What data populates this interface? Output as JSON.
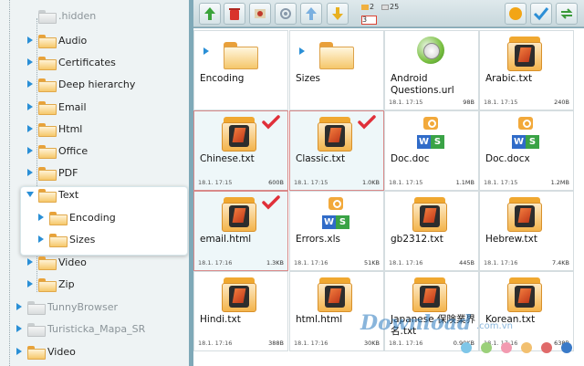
{
  "tree": {
    "items": [
      {
        "label": ".hidden",
        "dim": true
      },
      {
        "label": "Audio"
      },
      {
        "label": "Certificates"
      },
      {
        "label": "Deep hierarchy"
      },
      {
        "label": "Email"
      },
      {
        "label": "Html"
      },
      {
        "label": "Office"
      },
      {
        "label": "PDF"
      },
      {
        "label": "Text",
        "expanded": true
      },
      {
        "label": "Encoding"
      },
      {
        "label": "Sizes"
      },
      {
        "label": "Video"
      },
      {
        "label": "Zip"
      },
      {
        "label": "TunnyBrowser",
        "dim": true
      },
      {
        "label": "Turisticka_Mapa_SR",
        "dim": true
      },
      {
        "label": "Video"
      }
    ]
  },
  "toolbar": {
    "buttons": [
      "up-arrow-icon",
      "delete-icon",
      "cut-icon",
      "settings-icon",
      "upload-icon",
      "download-icon"
    ],
    "counter": {
      "folders": "2",
      "files": "25",
      "selected": "3"
    },
    "right_buttons": [
      "sun-icon",
      "check-icon",
      "refresh-icon"
    ]
  },
  "grid": {
    "cells": [
      {
        "name": "Encoding",
        "type": "folder",
        "date": "",
        "size": ""
      },
      {
        "name": "Sizes",
        "type": "folder",
        "date": "",
        "size": ""
      },
      {
        "name": "Android Questions.url",
        "type": "url",
        "date": "18.1. 17:15",
        "size": "98B"
      },
      {
        "name": "Arabic.txt",
        "type": "txt",
        "date": "18.1. 17:15",
        "size": "240B"
      },
      {
        "name": "Chinese.txt",
        "type": "txt",
        "date": "18.1. 17:15",
        "size": "600B",
        "selected": true
      },
      {
        "name": "Classic.txt",
        "type": "txt",
        "date": "18.1. 17:15",
        "size": "1.0KB",
        "selected": true
      },
      {
        "name": "Doc.doc",
        "type": "office",
        "date": "18.1. 17:15",
        "size": "1.1MB"
      },
      {
        "name": "Doc.docx",
        "type": "office",
        "date": "18.1. 17:15",
        "size": "1.2MB"
      },
      {
        "name": "email.html",
        "type": "txt",
        "date": "18.1. 17:16",
        "size": "1.3KB",
        "selected": true
      },
      {
        "name": "Errors.xls",
        "type": "office",
        "date": "18.1. 17:16",
        "size": "51KB"
      },
      {
        "name": "gb2312.txt",
        "type": "txt",
        "date": "18.1. 17:16",
        "size": "445B"
      },
      {
        "name": "Hebrew.txt",
        "type": "txt",
        "date": "18.1. 17:16",
        "size": "7.4KB"
      },
      {
        "name": "Hindi.txt",
        "type": "txt",
        "date": "18.1. 17:16",
        "size": "388B"
      },
      {
        "name": "html.html",
        "type": "txt",
        "date": "18.1. 17:16",
        "size": "30KB"
      },
      {
        "name": "Japanese 保険業界名.txt",
        "type": "txt",
        "date": "18.1. 17:16",
        "size": "0.90KB"
      },
      {
        "name": "Korean.txt",
        "type": "txt",
        "date": "18.1. 17:16",
        "size": "638B"
      }
    ]
  },
  "watermark": {
    "text": "Download",
    "sub": ".com.vn"
  },
  "colors": {
    "accent": "#2a8fd6",
    "selection_border": "#d98a8a",
    "check": "#e0303a",
    "grid_bg": "#7fa9b8"
  }
}
